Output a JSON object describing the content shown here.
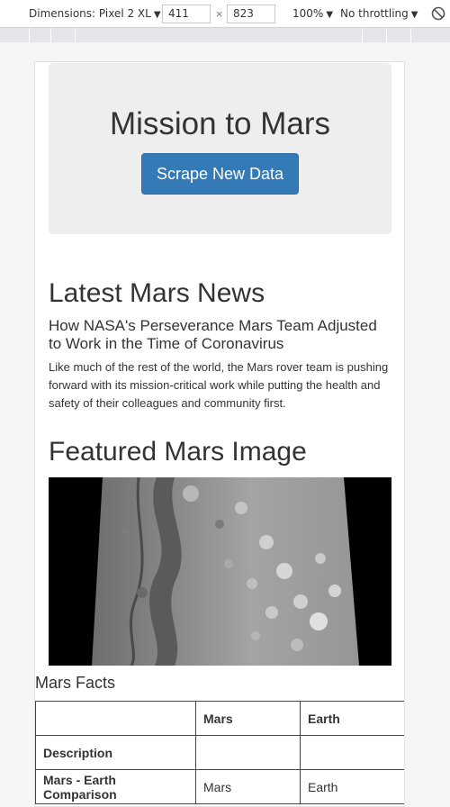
{
  "devtools": {
    "dimensions_label": "Dimensions: Pixel 2 XL",
    "width": "411",
    "times": "×",
    "height": "823",
    "zoom": "100%",
    "throttling": "No throttling",
    "dropdown_glyph": "▼",
    "rotate_icon": "rotate-icon"
  },
  "jumbotron": {
    "title": "Mission to Mars",
    "button_label": "Scrape New Data"
  },
  "news": {
    "heading": "Latest Mars News",
    "title": "How NASA's Perseverance Mars Team Adjusted to Work in the Time of Coronavirus",
    "teaser": "Like much of the rest of the world, the Mars rover team is pushing forward with its mission-critical work while putting the health and safety of their colleagues and community first."
  },
  "featured": {
    "heading": "Featured Mars Image"
  },
  "facts": {
    "heading": "Mars Facts",
    "columns": [
      "",
      "Mars",
      "Earth"
    ],
    "rows": [
      {
        "label": "Description",
        "mars": "",
        "earth": ""
      },
      {
        "label": "Mars - Earth Comparison",
        "mars": "Mars",
        "earth": "Earth"
      }
    ]
  },
  "colors": {
    "button": "#337ab7",
    "jumbotron": "#eeeeee"
  }
}
